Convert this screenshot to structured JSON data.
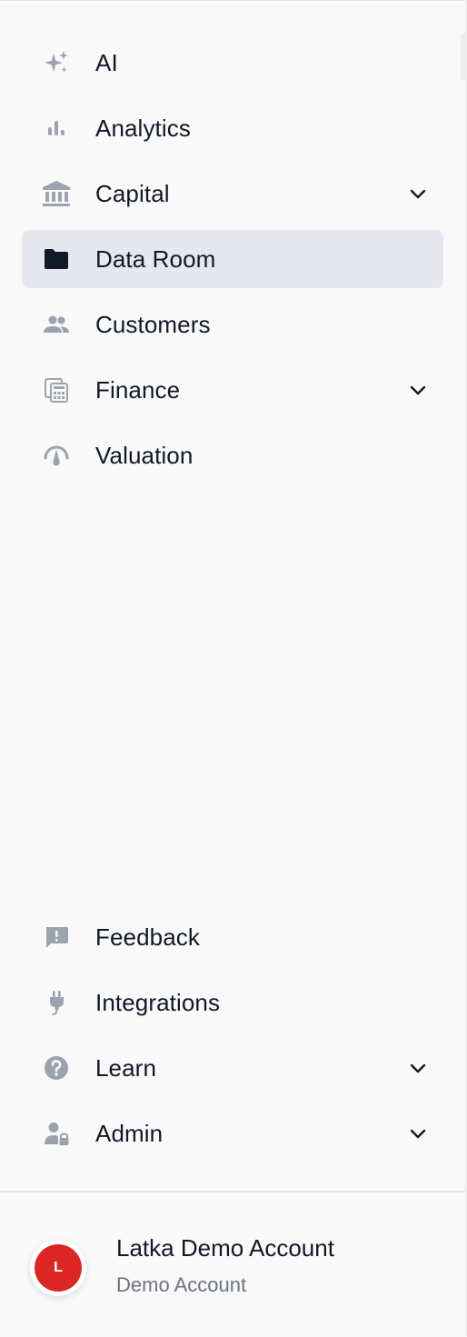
{
  "nav": {
    "items": [
      {
        "label": "AI",
        "icon": "sparkles-icon",
        "has_dropdown": false
      },
      {
        "label": "Analytics",
        "icon": "bar-chart-icon",
        "has_dropdown": false
      },
      {
        "label": "Capital",
        "icon": "bank-icon",
        "has_dropdown": true
      },
      {
        "label": "Data Room",
        "icon": "folder-icon",
        "has_dropdown": false,
        "active": true
      },
      {
        "label": "Customers",
        "icon": "people-icon",
        "has_dropdown": false
      },
      {
        "label": "Finance",
        "icon": "calculator-icon",
        "has_dropdown": true
      },
      {
        "label": "Valuation",
        "icon": "gauge-icon",
        "has_dropdown": false
      }
    ],
    "bottom_items": [
      {
        "label": "Feedback",
        "icon": "feedback-icon",
        "has_dropdown": false
      },
      {
        "label": "Integrations",
        "icon": "plug-icon",
        "has_dropdown": false
      },
      {
        "label": "Learn",
        "icon": "help-icon",
        "has_dropdown": true
      },
      {
        "label": "Admin",
        "icon": "admin-lock-icon",
        "has_dropdown": true
      }
    ]
  },
  "account": {
    "avatar_initial": "L",
    "name": "Latka Demo Account",
    "subtitle": "Demo Account"
  },
  "colors": {
    "background": "#f9f9f9",
    "active_item_bg": "#e6e8ef",
    "icon_gray": "#9ca3af",
    "active_icon": "#111827",
    "avatar_red": "#dc2626",
    "subtitle_gray": "#6b7280"
  }
}
